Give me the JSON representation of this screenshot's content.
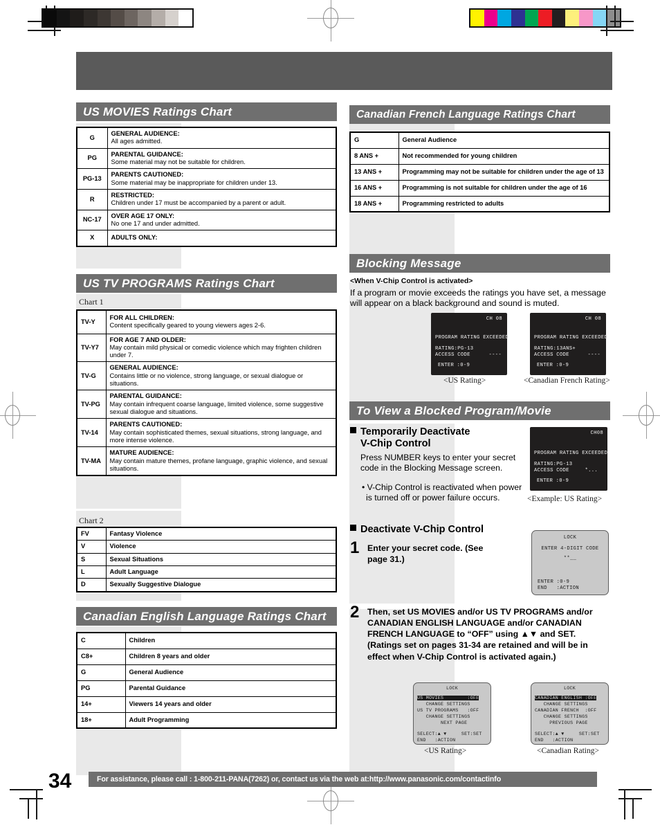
{
  "page": {
    "number": "34",
    "footer_text": "For assistance, please call : 1-800-211-PANA(7262) or, contact us via the web at:http://www.panasonic.com/contactinfo"
  },
  "sections": {
    "us_movies": {
      "title": "US MOVIES Ratings Chart",
      "rows": [
        {
          "code": "G",
          "title": "GENERAL AUDIENCE:",
          "body": "All ages admitted."
        },
        {
          "code": "PG",
          "title": "PARENTAL GUIDANCE:",
          "body": "Some material may not be suitable for children."
        },
        {
          "code": "PG-13",
          "title": "PARENTS CAUTIONED:",
          "body": "Some material may be inappropriate for children under 13."
        },
        {
          "code": "R",
          "title": "RESTRICTED:",
          "body": "Children under 17 must be accompanied by a parent or adult."
        },
        {
          "code": "NC-17",
          "title": "OVER AGE 17 ONLY:",
          "body": "No one 17 and under admitted."
        },
        {
          "code": "X",
          "title": "ADULTS ONLY:",
          "body": ""
        }
      ]
    },
    "us_tv": {
      "title": "US TV PROGRAMS Ratings Chart",
      "chart1_label": "Chart 1",
      "chart1_rows": [
        {
          "code": "TV-Y",
          "title": "FOR ALL CHILDREN:",
          "body": "Content specifically geared to young viewers ages 2-6."
        },
        {
          "code": "TV-Y7",
          "title": "FOR AGE 7 AND OLDER:",
          "body": "May contain mild physical or comedic violence which may frighten children under 7."
        },
        {
          "code": "TV-G",
          "title": "GENERAL AUDIENCE:",
          "body": "Contains little or no violence, strong language, or sexual dialogue or situations."
        },
        {
          "code": "TV-PG",
          "title": "PARENTAL GUIDANCE:",
          "body": "May contain infrequent coarse language, limited violence, some suggestive sexual dialogue and situations."
        },
        {
          "code": "TV-14",
          "title": "PARENTS CAUTIONED:",
          "body": "May contain sophisticated themes, sexual situations, strong language, and more intense violence."
        },
        {
          "code": "TV-MA",
          "title": "MATURE AUDIENCE:",
          "body": "May contain mature themes, profane language, graphic violence, and sexual situations."
        }
      ],
      "chart2_label": "Chart 2",
      "chart2_rows": [
        {
          "code": "FV",
          "body": "Fantasy Violence"
        },
        {
          "code": "V",
          "body": "Violence"
        },
        {
          "code": "S",
          "body": "Sexual Situations"
        },
        {
          "code": "L",
          "body": "Adult Language"
        },
        {
          "code": "D",
          "body": "Sexually Suggestive Dialogue"
        }
      ]
    },
    "canadian_english": {
      "title": "Canadian English Language Ratings Chart",
      "rows": [
        {
          "code": "C",
          "body": "Children"
        },
        {
          "code": "C8+",
          "body": "Children 8 years and older"
        },
        {
          "code": "G",
          "body": "General Audience"
        },
        {
          "code": "PG",
          "body": "Parental Guidance"
        },
        {
          "code": "14+",
          "body": "Viewers 14 years and older"
        },
        {
          "code": "18+",
          "body": "Adult Programming"
        }
      ]
    },
    "canadian_french": {
      "title": "Canadian French Language Ratings Chart",
      "rows": [
        {
          "code": "G",
          "body": "General Audience"
        },
        {
          "code": "8 ANS +",
          "body": "Not recommended for young children"
        },
        {
          "code": "13 ANS +",
          "body": "Programming may not be suitable for children under the age of 13"
        },
        {
          "code": "16 ANS +",
          "body": "Programming is not suitable for children under the age of 16"
        },
        {
          "code": "18 ANS +",
          "body": "Programming restricted to adults"
        }
      ]
    },
    "blocking_message": {
      "title": "Blocking Message",
      "subtitle": "<When V-Chip Control is activated>",
      "paragraph": "If a program or movie exceeds the ratings you have set, a message will appear on a black background and sound is muted.",
      "screen_us": {
        "channel": "CH 08",
        "line1": "PROGRAM RATING EXCEEDED",
        "line2": "RATING:PG-13",
        "line3": "ACCESS CODE",
        "line3b": "----",
        "line4": "ENTER :0-9",
        "caption": "<US Rating>"
      },
      "screen_cf": {
        "channel": "CH 08",
        "line1": "PROGRAM RATING EXCEEDED",
        "line2": "RATING:13ANS+",
        "line3": "ACCESS CODE",
        "line3b": "----",
        "line4": "ENTER :0-9",
        "caption": "<Canadian French Rating>"
      }
    },
    "to_view": {
      "title": "To View a Blocked Program/Movie",
      "temp_heading_line1": "Temporarily Deactivate",
      "temp_heading_line2": "V-Chip Control",
      "temp_body": "Press NUMBER keys to enter your secret code in the Blocking Message screen.",
      "temp_bullet": "• V-Chip Control is reactivated when power is turned off or power failure occurs.",
      "example_screen": {
        "channel": "CH08",
        "line1": "PROGRAM RATING EXCEEDED",
        "line2": "RATING:PG-13",
        "line3": "ACCESS CODE",
        "line3b": "*...",
        "line4": "ENTER :0-9",
        "caption": "<Example: US Rating>"
      },
      "deactivate_heading": "Deactivate V-Chip Control",
      "step1_num": "1",
      "step1_text": "Enter your secret code. (See page 31.)",
      "step1_screen": {
        "title": "LOCK",
        "line1": "ENTER 4-DIGIT CODE",
        "line2": "**__",
        "line3": "ENTER :0-9",
        "line4": "END   :ACTION"
      },
      "step2_num": "2",
      "step2_text": "Then, set US MOVIES and/or US TV PROGRAMS and/or CANADIAN ENGLISH LANGUAGE and/or CANADIAN FRENCH LANGUAGE to “OFF” using ▲▼ and SET. (Ratings set on pages 31-34 are retained and will be in effect when V-Chip Control is activated again.)",
      "step2_screen_us": {
        "title": "LOCK",
        "line1": "US MOVIES        :OFF",
        "line2": "   CHANGE SETTINGS",
        "line3": "US TV PROGRAMS   :OFF",
        "line4": "   CHANGE SETTINGS",
        "line5": "        NEXT PAGE",
        "line6": "SELECT:▲ ▼     SET:SET",
        "line7": "END   :ACTION",
        "caption": "<US Rating>"
      },
      "step2_screen_cdn": {
        "title": "LOCK",
        "line1": "CANADIAN ENGLISH :OFF",
        "line2": "   CHANGE SETTINGS",
        "line3": "CANADIAN FRENCH  :OFF",
        "line4": "   CHANGE SETTINGS",
        "line5": "     PREVIOUS PAGE",
        "line6": "SELECT:▲ ▼     SET:SET",
        "line7": "END   :ACTION",
        "caption": "<Canadian Rating>"
      }
    }
  },
  "colors": {
    "header_gray": "#6f6f6f",
    "banner_gray": "#5a5a5a",
    "panel_gray": "#e9e9e9",
    "osd_dark": "#201e1e",
    "osd_light": "#c9c9c9"
  },
  "registration": {
    "gray_ramp": [
      "#0a0a0a",
      "#141414",
      "#1f1c1a",
      "#2d2926",
      "#3d3733",
      "#544c47",
      "#6d6560",
      "#8d8681",
      "#b4ada8",
      "#d6d1cd",
      "#ffffff"
    ],
    "color_bars": [
      "#fff200",
      "#ec008c",
      "#00a7e1",
      "#2e3192",
      "#00a651",
      "#ed1c24",
      "#231f20",
      "#fdf07c",
      "#f797c8",
      "#86d6f5",
      "#8c8c8c"
    ]
  }
}
